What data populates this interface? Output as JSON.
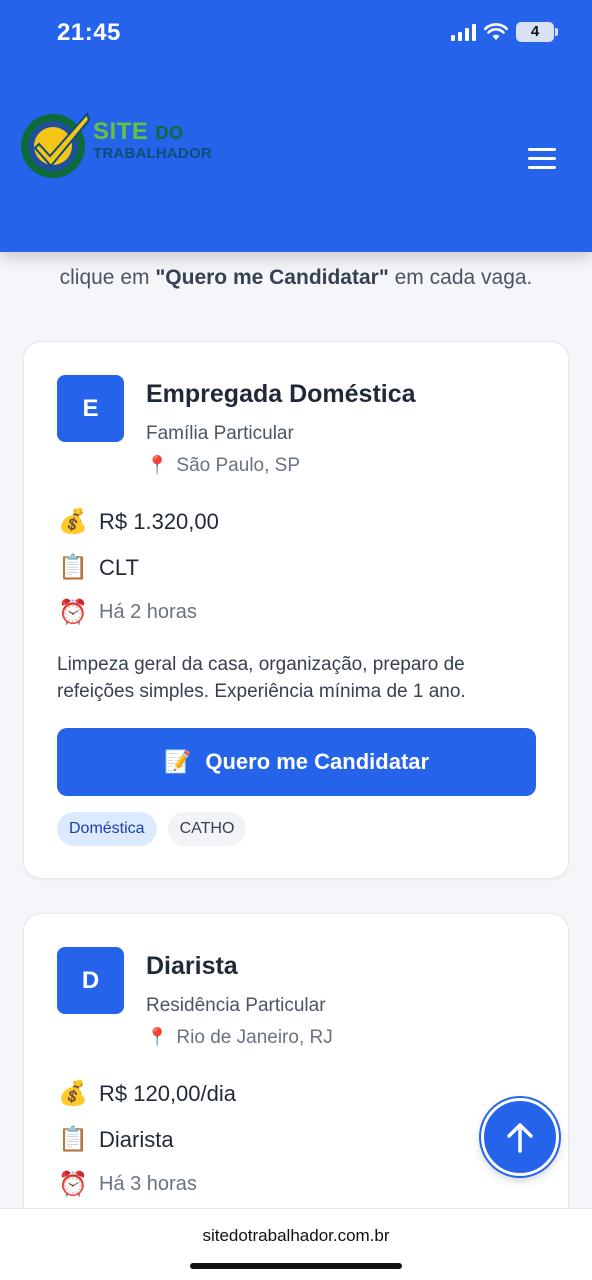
{
  "status": {
    "time": "21:45",
    "battery": "4"
  },
  "header": {
    "logo_line1": "SITE",
    "logo_line1_small": "DO",
    "logo_line2": "TRABALHADOR"
  },
  "intro": {
    "prefix": "clique em ",
    "highlight": "\"Quero me Candidatar\"",
    "suffix": " em cada vaga."
  },
  "jobs": [
    {
      "initial": "E",
      "title": "Empregada Doméstica",
      "company": "Família Particular",
      "location": "São Paulo, SP",
      "salary": "R$ 1.320,00",
      "contract": "CLT",
      "posted": "Há 2 horas",
      "description": "Limpeza geral da casa, organização, preparo de refeições simples. Experiência mínima de 1 ano.",
      "apply_label": "Quero me Candidatar",
      "tags": [
        "Doméstica",
        "CATHO"
      ]
    },
    {
      "initial": "D",
      "title": "Diarista",
      "company": "Residência Particular",
      "location": "Rio de Janeiro, RJ",
      "salary": "R$ 120,00/dia",
      "contract": "Diarista",
      "posted": "Há 3 horas"
    }
  ],
  "browser": {
    "url": "sitedotrabalhador.com.br"
  },
  "icons": {
    "pin": "📍",
    "money": "💰",
    "clipboard": "📋",
    "clock": "⏰",
    "memo": "📝"
  },
  "colors": {
    "primary": "#2563eb",
    "logo_green": "#65c23a",
    "logo_check": "#f5c518"
  }
}
